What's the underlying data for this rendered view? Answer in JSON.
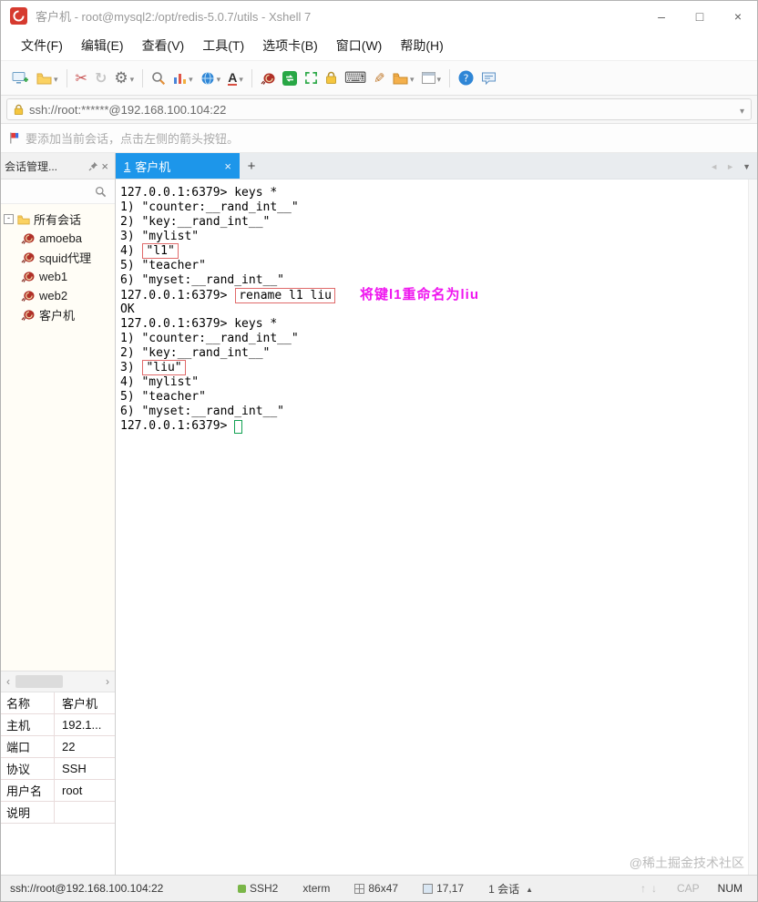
{
  "window": {
    "title": "客户机 - root@mysql2:/opt/redis-5.0.7/utils - Xshell 7",
    "controls": {
      "minimize": "–",
      "maximize": "□",
      "close": "×"
    }
  },
  "menu": {
    "items": [
      "文件(F)",
      "编辑(E)",
      "查看(V)",
      "工具(T)",
      "选项卡(B)",
      "窗口(W)",
      "帮助(H)"
    ]
  },
  "toolbar": {
    "icons": [
      "new-session",
      "open-session",
      "disconnect",
      "reconnect",
      "session-properties",
      "find",
      "quick-commands",
      "encoding",
      "font",
      "launch-xagent",
      "new-xftp-session",
      "full-screen",
      "lock-screen",
      "virtual-keyboard",
      "compose",
      "file-transfer",
      "window-layout",
      "help",
      "feedback"
    ]
  },
  "address_bar": {
    "value": "ssh://root:******@192.168.100.104:22"
  },
  "info_bar": {
    "message": "要添加当前会话，点击左侧的箭头按钮。"
  },
  "session_panel": {
    "title": "会话管理...",
    "root": "所有会话",
    "items": [
      "amoeba",
      "squid代理",
      "web1",
      "web2",
      "客户机"
    ]
  },
  "tabs": {
    "active_number": "1",
    "active_label": "客户机"
  },
  "terminal": {
    "lines": [
      {
        "pre": "127.0.0.1:6379> keys *"
      },
      {
        "pre": "1) \"counter:__rand_int__\""
      },
      {
        "pre": "2) \"key:__rand_int__\""
      },
      {
        "pre": "3) \"mylist\""
      },
      {
        "pre": "4) ",
        "boxed": "\"l1\""
      },
      {
        "pre": "5) \"teacher\""
      },
      {
        "pre": "6) \"myset:__rand_int__\""
      },
      {
        "pre": "127.0.0.1:6379> ",
        "boxed": "rename l1 liu",
        "note": "将键l1重命名为liu"
      },
      {
        "pre": "OK"
      },
      {
        "pre": "127.0.0.1:6379> keys *"
      },
      {
        "pre": "1) \"counter:__rand_int__\""
      },
      {
        "pre": "2) \"key:__rand_int__\""
      },
      {
        "pre": "3) ",
        "boxed": "\"liu\""
      },
      {
        "pre": "4) \"mylist\""
      },
      {
        "pre": "5) \"teacher\""
      },
      {
        "pre": "6) \"myset:__rand_int__\""
      },
      {
        "pre": "127.0.0.1:6379> ",
        "cursor": " "
      }
    ]
  },
  "properties": {
    "rows": [
      {
        "label": "名称",
        "value": "客户机"
      },
      {
        "label": "主机",
        "value": "192.1..."
      },
      {
        "label": "端口",
        "value": "22"
      },
      {
        "label": "协议",
        "value": "SSH"
      },
      {
        "label": "用户名",
        "value": "root"
      },
      {
        "label": "说明",
        "value": ""
      }
    ]
  },
  "status_bar": {
    "address": "ssh://root@192.168.100.104:22",
    "protocol": "SSH2",
    "terminal_type": "xterm",
    "size": "86x47",
    "cursor_position": "17,17",
    "sessions": "1 会话",
    "cap": "CAP",
    "num": "NUM"
  },
  "watermark": "@稀土掘金技术社区"
}
